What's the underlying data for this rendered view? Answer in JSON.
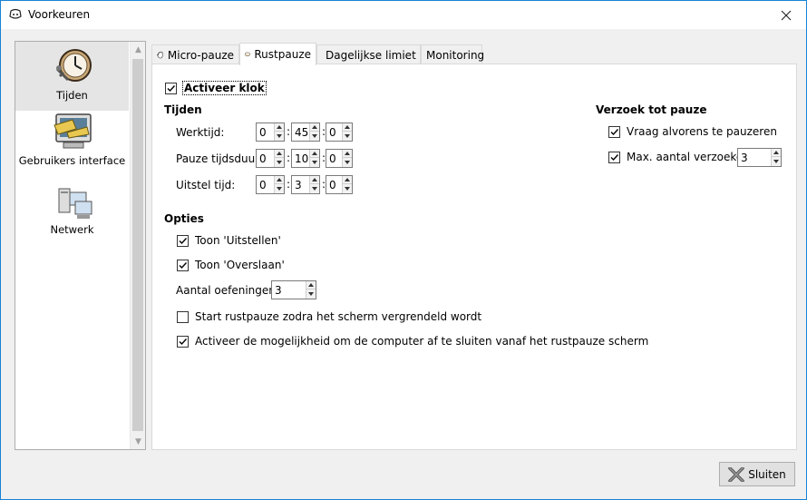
{
  "window": {
    "title": "Voorkeuren"
  },
  "sidebar": {
    "items": [
      {
        "label": "Tijden",
        "icon": "clock-icon",
        "active": true
      },
      {
        "label": "Gebruikers interface",
        "icon": "monitor-icon",
        "active": false
      },
      {
        "label": "Netwerk",
        "icon": "network-icon",
        "active": false
      }
    ]
  },
  "tabs": [
    {
      "label": "Micro-pauze",
      "icon": "hand-icon"
    },
    {
      "label": "Rustpauze",
      "icon": "cup-icon",
      "active": true
    },
    {
      "label": "Dagelijkse limiet",
      "icon": "exit-icon"
    },
    {
      "label": "Monitoring",
      "icon": ""
    }
  ],
  "panel": {
    "activate_clock": {
      "label": "Activeer klok",
      "checked": true
    },
    "times": {
      "heading": "Tijden",
      "rows": [
        {
          "label": "Werktijd:",
          "h": "0",
          "m": "45",
          "s": "0"
        },
        {
          "label": "Pauze tijdsduur:",
          "h": "0",
          "m": "10",
          "s": "0"
        },
        {
          "label": "Uitstel tijd:",
          "h": "0",
          "m": "3",
          "s": "0"
        }
      ],
      "separator": ":"
    },
    "request": {
      "heading": "Verzoek tot pauze",
      "ask_before": {
        "label": "Vraag alvorens te pauzeren",
        "checked": true
      },
      "max_requests": {
        "label": "Max. aantal verzoeken:",
        "checked": true,
        "value": "3"
      }
    },
    "options": {
      "heading": "Opties",
      "show_postpone": {
        "label": "Toon 'Uitstellen'",
        "checked": true
      },
      "show_skip": {
        "label": "Toon 'Overslaan'",
        "checked": true
      },
      "exercises": {
        "label": "Aantal oefeningen:",
        "value": "3"
      },
      "start_on_lock": {
        "label": "Start rustpauze zodra het scherm vergrendeld wordt",
        "checked": false
      },
      "shutdown": {
        "label": "Activeer de mogelijkheid om de computer af te sluiten vanaf het rustpauze scherm",
        "checked": true
      }
    }
  },
  "footer": {
    "close_label": "Sluiten"
  },
  "colors": {
    "accent": "#1783d7",
    "check": "#000000"
  }
}
